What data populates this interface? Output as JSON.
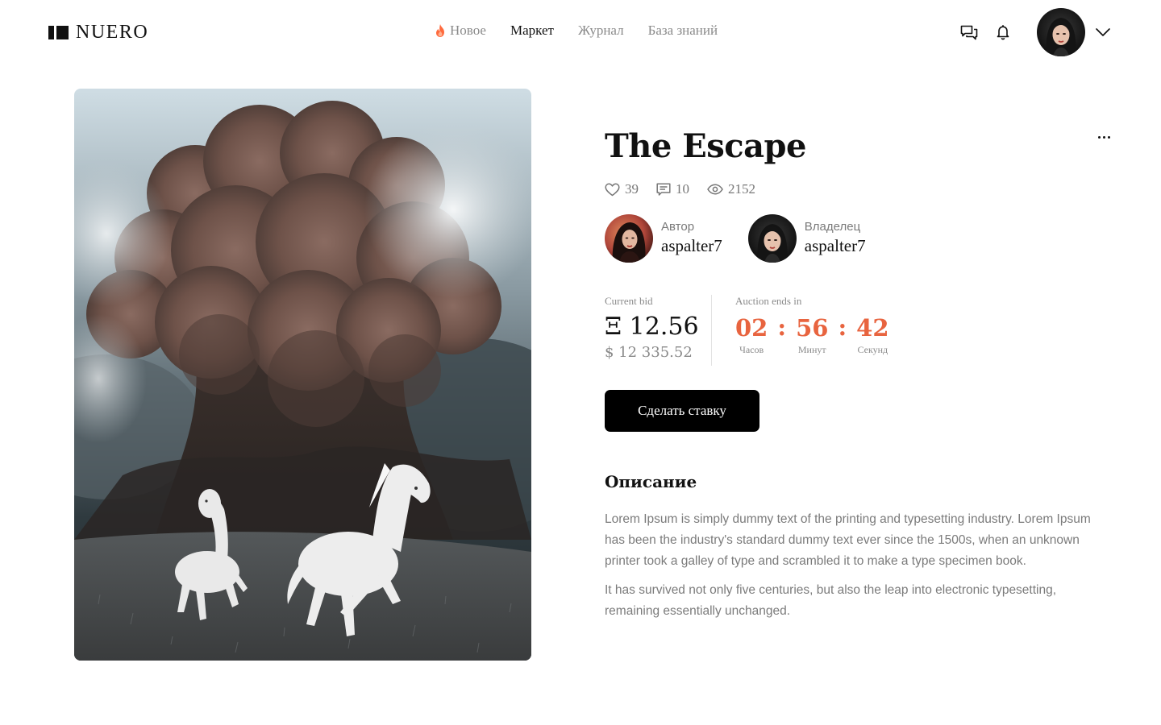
{
  "header": {
    "logo_text": "NUERO",
    "nav": [
      {
        "label": "Новое",
        "icon": "flame-icon",
        "active": false
      },
      {
        "label": "Маркет",
        "active": true
      },
      {
        "label": "Журнал",
        "active": false
      },
      {
        "label": "База знаний",
        "active": false
      }
    ],
    "icons": [
      "chat-icon",
      "bell-icon",
      "chevron-down-icon"
    ]
  },
  "artwork": {
    "icons": [
      "artwork-image"
    ]
  },
  "item": {
    "title": "The Escape",
    "likes": "39",
    "comments": "10",
    "views": "2152"
  },
  "people": {
    "author_role": "Автор",
    "author_name": "aspalter7",
    "owner_role": "Владелец",
    "owner_name": "aspalter7"
  },
  "bid": {
    "label": "Current bid",
    "eth": "Ξ 12.56",
    "usd": "$ 12 335.52"
  },
  "auction": {
    "label": "Auction ends in",
    "hours": "02",
    "minutes": "56",
    "seconds": "42",
    "separator": ":",
    "hours_label": "Часов",
    "minutes_label": "Минут",
    "seconds_label": "Секунд"
  },
  "cta": {
    "bid_button": "Сделать ставку"
  },
  "description": {
    "title": "Описание",
    "p1": "Lorem Ipsum is simply dummy text of the printing and typesetting industry. Lorem Ipsum has been the industry's standard dummy text ever since the 1500s, when an unknown printer took a galley of type and scrambled it to make a type specimen book.",
    "p2": "It has survived not only five centuries, but also the leap into electronic typesetting, remaining essentially unchanged."
  },
  "colors": {
    "accent": "#e8643f",
    "text": "#111111",
    "muted": "#8a8a8a",
    "button_bg": "#000000"
  }
}
